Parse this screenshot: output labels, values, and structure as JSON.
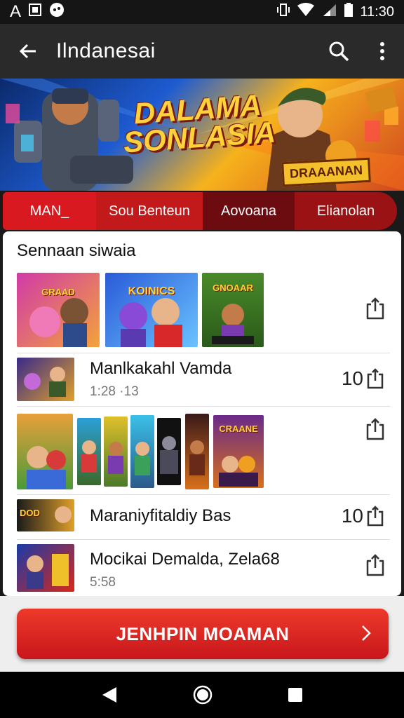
{
  "status": {
    "left_text": "A",
    "time": "11:30"
  },
  "app_bar": {
    "title": "Ilndanesai"
  },
  "banner": {
    "title_line1": "DALAMA",
    "title_line2": "SONLASIA",
    "badge": "DRAAANAN"
  },
  "tabs": [
    {
      "label": "MAN_"
    },
    {
      "label": "Sou Benteun"
    },
    {
      "label": "Aovoana"
    },
    {
      "label": "Elianolan"
    }
  ],
  "section": {
    "title": "Sennaan siwaia"
  },
  "thumb_labels": {
    "t1": "GRAAD",
    "t2": "KOINICS",
    "t3": "GNOAAR",
    "t6": "CRAANE",
    "t7": "DOD"
  },
  "items": [
    {
      "title": "Manlkakahl Vamda",
      "subtitle": "1:28 ·13",
      "count": "10"
    },
    {
      "title": "Maraniyfitaldiy Bas",
      "count": "10"
    },
    {
      "title": "Mocikai Demalda, Zela68",
      "subtitle": "5:58"
    }
  ],
  "cta": {
    "label": "JENHPIN MOAMAN"
  },
  "colors": {
    "accent": "#d8191f",
    "app_bar": "#2a2a2a"
  }
}
